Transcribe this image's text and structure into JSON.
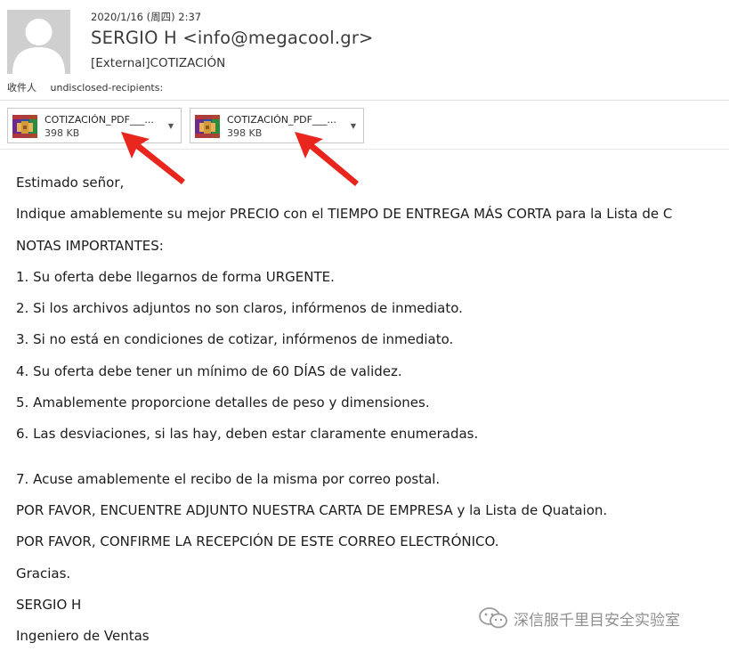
{
  "email": {
    "date": "2020/1/16 (周四) 2:37",
    "sender": "SERGIO H <info@megacool.gr>",
    "subject": "[External]COTIZACIÓN",
    "to_label": "收件人",
    "to_value": "undisclosed-recipients:"
  },
  "attachments": [
    {
      "name": "COTIZACIÓN_PDF___...",
      "size": "398 KB",
      "icon": "winrar-archive-icon"
    },
    {
      "name": "COTIZACIÓN_PDF___...",
      "size": "398 KB",
      "icon": "winrar-archive-icon"
    }
  ],
  "body": {
    "greeting": "Estimado señor,",
    "intro": "Indique amablemente su mejor PRECIO con el TIEMPO DE ENTREGA MÁS CORTA para la Lista de C",
    "notes_heading": "NOTAS IMPORTANTES:",
    "notes": [
      "1. Su oferta debe llegarnos de forma URGENTE.",
      "2. Si los archivos adjuntos no son claros, infórmenos de inmediato.",
      "3. Si no está en condiciones de cotizar, infórmenos de inmediato.",
      "4. Su oferta debe tener un mínimo de 60 DÍAS de validez.",
      "5. Amablemente proporcione detalles de peso y dimensiones.",
      "6. Las desviaciones, si las hay, deben estar claramente enumeradas.",
      "7. Acuse amablemente el recibo de la misma por correo postal."
    ],
    "line_attach": "POR FAVOR, ENCUENTRE ADJUNTO NUESTRA CARTA DE EMPRESA y la Lista de Quataion.",
    "line_confirm": "POR FAVOR, CONFIRME LA RECEPCIÓN DE ESTE CORREO ELECTRÓNICO.",
    "thanks": "Gracias.",
    "signature_name": "SERGIO H",
    "signature_title": "Ingeniero de Ventas"
  },
  "watermark": {
    "text": "深信服千里目安全实验室",
    "icon": "wechat-icon"
  },
  "colors": {
    "arrow": "#e8261e",
    "avatar_bg": "#cfcfcf"
  }
}
